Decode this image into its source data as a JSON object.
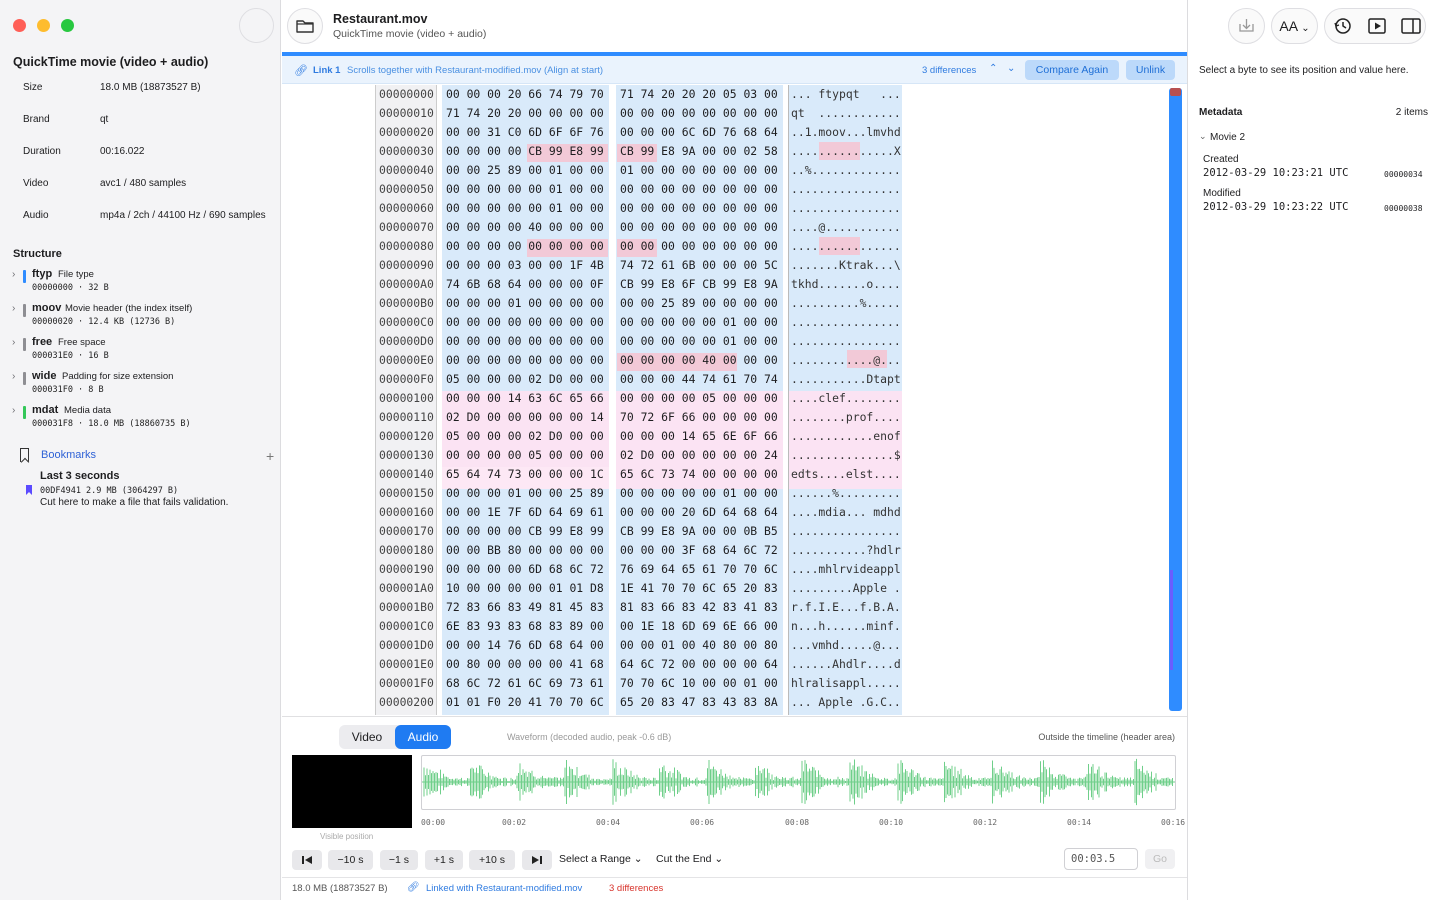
{
  "colors": {
    "accent": "#2f8cff",
    "diff_pink": "#f2c9d7",
    "diff_text": "#d8332b",
    "wave_green": "#6fcf8a"
  },
  "window": {
    "title": "Restaurant.mov",
    "subtitle": "QuickTime movie (video + audio)"
  },
  "sidebar": {
    "title": "QuickTime movie (video + audio)",
    "properties": [
      {
        "key": "Size",
        "value": "18.0 MB (18873527 B)"
      },
      {
        "key": "Brand",
        "value": "qt"
      },
      {
        "key": "Duration",
        "value": "00:16.022"
      },
      {
        "key": "Video",
        "value": "avc1 / 480 samples"
      },
      {
        "key": "Audio",
        "value": "mp4a / 2ch / 44100 Hz / 690 samples"
      }
    ],
    "structure_heading": "Structure",
    "atoms": [
      {
        "name": "ftyp",
        "desc": "File type",
        "meta": "00000000 · 32 B",
        "color": "#2f8cff"
      },
      {
        "name": "moov",
        "desc": "Movie header (the index itself)",
        "meta": "00000020 · 12.4 KB (12736 B)",
        "color": "#8e8e93"
      },
      {
        "name": "free",
        "desc": "Free space",
        "meta": "000031E0 · 16 B",
        "color": "#8e8e93"
      },
      {
        "name": "wide",
        "desc": "Padding for size extension",
        "meta": "000031F0 · 8 B",
        "color": "#8e8e93"
      },
      {
        "name": "mdat",
        "desc": "Media data",
        "meta": "000031F8 · 18.0 MB (18860735 B)",
        "color": "#34c759"
      }
    ],
    "bookmarks_heading": "Bookmarks",
    "bookmark": {
      "title": "Last 3 seconds",
      "meta": "00DF4941  2.9 MB (3064297 B)",
      "note": "Cut here to make a file that fails validation."
    }
  },
  "linkbar": {
    "label": "Link 1",
    "desc": "Scrolls together with Restaurant-modified.mov (Align at start)",
    "diffs": "3 differences",
    "compare_label": "Compare Again",
    "unlink_label": "Unlink"
  },
  "hex_rows": [
    {
      "off": "00000000",
      "a": "00 00 00 20 66 74 79 70",
      "b": "71 74 20 20 20 05 03 00",
      "asc": "... ftypqt   ..."
    },
    {
      "off": "00000010",
      "a": "71 74 20 20 00 00 00 00",
      "b": "00 00 00 00 00 00 00 00",
      "asc": "qt  ............"
    },
    {
      "off": "00000020",
      "a": "00 00 31 C0 6D 6F 6F 76",
      "b": "00 00 00 6C 6D 76 68 64",
      "asc": "..1.moov...lmvhd"
    },
    {
      "off": "00000030",
      "a": "00 00 00 00 CB 99 E8 99",
      "b": "CB 99 E8 9A 00 00 02 58",
      "asc": "...............X"
    },
    {
      "off": "00000040",
      "a": "00 00 25 89 00 01 00 00",
      "b": "01 00 00 00 00 00 00 00",
      "asc": "..%............."
    },
    {
      "off": "00000050",
      "a": "00 00 00 00 00 01 00 00",
      "b": "00 00 00 00 00 00 00 00",
      "asc": "................"
    },
    {
      "off": "00000060",
      "a": "00 00 00 00 00 01 00 00",
      "b": "00 00 00 00 00 00 00 00",
      "asc": "................"
    },
    {
      "off": "00000070",
      "a": "00 00 00 00 40 00 00 00",
      "b": "00 00 00 00 00 00 00 00",
      "asc": "....@..........."
    },
    {
      "off": "00000080",
      "a": "00 00 00 00 00 00 00 00",
      "b": "00 00 00 00 00 00 00 00",
      "asc": "................"
    },
    {
      "off": "00000090",
      "a": "00 00 00 03 00 00 1F 4B",
      "b": "74 72 61 6B 00 00 00 5C",
      "asc": ".......Ktrak...\\"
    },
    {
      "off": "000000A0",
      "a": "74 6B 68 64 00 00 00 0F",
      "b": "CB 99 E8 6F CB 99 E8 9A",
      "asc": "tkhd.......o...."
    },
    {
      "off": "000000B0",
      "a": "00 00 00 01 00 00 00 00",
      "b": "00 00 25 89 00 00 00 00",
      "asc": "..........%....."
    },
    {
      "off": "000000C0",
      "a": "00 00 00 00 00 00 00 00",
      "b": "00 00 00 00 00 01 00 00",
      "asc": "................"
    },
    {
      "off": "000000D0",
      "a": "00 00 00 00 00 00 00 00",
      "b": "00 00 00 00 00 01 00 00",
      "asc": "................"
    },
    {
      "off": "000000E0",
      "a": "00 00 00 00 00 00 00 00",
      "b": "00 00 00 00 40 00 00 00",
      "asc": "............@..."
    },
    {
      "off": "000000F0",
      "a": "05 00 00 00 02 D0 00 00",
      "b": "00 00 00 44 74 61 70 74",
      "asc": "...........Dtapt"
    },
    {
      "off": "00000100",
      "a": "00 00 00 14 63 6C 65 66",
      "b": "00 00 00 00 05 00 00 00",
      "asc": "....clef........"
    },
    {
      "off": "00000110",
      "a": "02 D0 00 00 00 00 00 14",
      "b": "70 72 6F 66 00 00 00 00",
      "asc": "........prof...."
    },
    {
      "off": "00000120",
      "a": "05 00 00 00 02 D0 00 00",
      "b": "00 00 00 14 65 6E 6F 66",
      "asc": "............enof"
    },
    {
      "off": "00000130",
      "a": "00 00 00 00 05 00 00 00",
      "b": "02 D0 00 00 00 00 00 24",
      "asc": "...............$"
    },
    {
      "off": "00000140",
      "a": "65 64 74 73 00 00 00 1C",
      "b": "65 6C 73 74 00 00 00 00",
      "asc": "edts....elst...."
    },
    {
      "off": "00000150",
      "a": "00 00 00 01 00 00 25 89",
      "b": "00 00 00 00 00 01 00 00",
      "asc": "......%........."
    },
    {
      "off": "00000160",
      "a": "00 00 1E 7F 6D 64 69 61",
      "b": "00 00 00 20 6D 64 68 64",
      "asc": "....mdia... mdhd"
    },
    {
      "off": "00000170",
      "a": "00 00 00 00 CB 99 E8 99",
      "b": "CB 99 E8 9A 00 00 0B B5",
      "asc": "................"
    },
    {
      "off": "00000180",
      "a": "00 00 BB 80 00 00 00 00",
      "b": "00 00 00 3F 68 64 6C 72",
      "asc": "...........?hdlr"
    },
    {
      "off": "00000190",
      "a": "00 00 00 00 6D 68 6C 72",
      "b": "76 69 64 65 61 70 70 6C",
      "asc": "....mhlrvideappl"
    },
    {
      "off": "000001A0",
      "a": "10 00 00 00 00 01 01 D8",
      "b": "1E 41 70 70 6C 65 20 83",
      "asc": ".........Apple ."
    },
    {
      "off": "000001B0",
      "a": "72 83 66 83 49 81 45 83",
      "b": "81 83 66 83 42 83 41 83",
      "asc": "r.f.I.E...f.B.A."
    },
    {
      "off": "000001C0",
      "a": "6E 83 93 83 68 83 89 00",
      "b": "00 1E 18 6D 69 6E 66 00",
      "asc": "n...h......minf."
    },
    {
      "off": "000001D0",
      "a": "00 00 14 76 6D 68 64 00",
      "b": "00 00 01 00 40 80 00 80",
      "asc": "...vmhd.....@..."
    },
    {
      "off": "000001E0",
      "a": "00 80 00 00 00 00 41 68",
      "b": "64 6C 72 00 00 00 00 64",
      "asc": "......Ahdlr....d"
    },
    {
      "off": "000001F0",
      "a": "68 6C 72 61 6C 69 73 61",
      "b": "70 70 6C 10 00 00 01 00",
      "asc": "hlralisappl....."
    },
    {
      "off": "00000200",
      "a": "01 01 F0 20 41 70 70 6C",
      "b": "65 20 83 47 83 43 83 8A",
      "asc": "... Apple .G.C.."
    }
  ],
  "media": {
    "tabs": [
      "Video",
      "Audio"
    ],
    "waveform_label": "Waveform (decoded audio, peak -0.6 dB)",
    "outside_label": "Outside the timeline (header area)",
    "visible_position": "Visible position",
    "ticks": [
      "00:00",
      "00:02",
      "00:04",
      "00:06",
      "00:08",
      "00:10",
      "00:12",
      "00:14",
      "00:16"
    ],
    "controls": {
      "back10": "−10 s",
      "back1": "−1 s",
      "fwd1": "+1 s",
      "fwd10": "+10 s",
      "select_range": "Select a Range",
      "cut_end": "Cut the End",
      "time_value": "00:03.5",
      "go": "Go"
    }
  },
  "status": {
    "size": "18.0 MB (18873527 B)",
    "linked": "Linked with Restaurant-modified.mov",
    "diffs": "3 differences"
  },
  "inspector": {
    "hint": "Select a byte to see its position and value here.",
    "metadata_heading": "Metadata",
    "count": "2 items",
    "movie_label": "Movie  2",
    "fields": [
      {
        "label": "Created",
        "value": "2012-03-29 10:23:21 UTC",
        "offset": "00000034"
      },
      {
        "label": "Modified",
        "value": "2012-03-29 10:23:22 UTC",
        "offset": "00000038"
      }
    ],
    "font_button": "AA"
  }
}
